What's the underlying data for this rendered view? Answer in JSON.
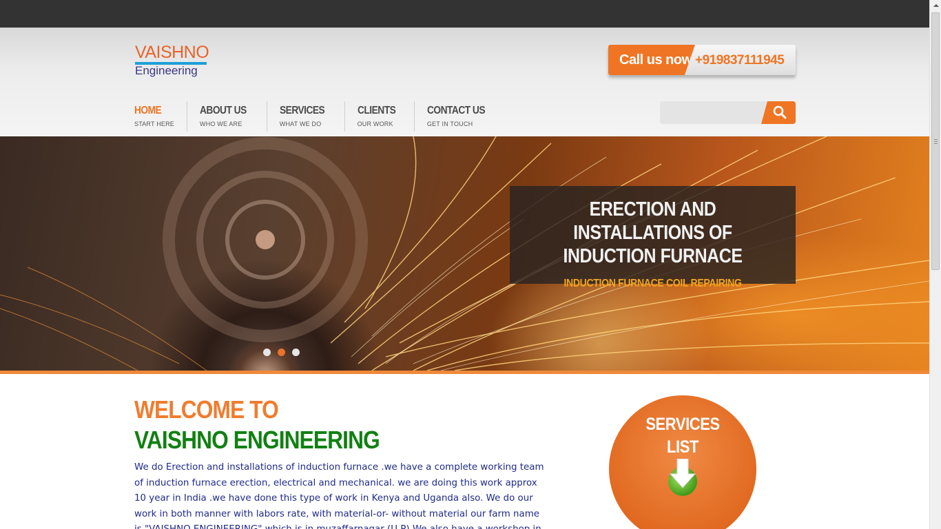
{
  "logo": {
    "line1": "VAISHNO",
    "line2": "Engineering"
  },
  "call": {
    "label": "Call us now",
    "number": "+919837111945"
  },
  "nav": [
    {
      "title": "HOME",
      "sub": "START HERE",
      "active": true
    },
    {
      "title": "ABOUT US",
      "sub": "WHO WE ARE"
    },
    {
      "title": "SERVICES",
      "sub": "WHAT WE DO"
    },
    {
      "title": "CLIENTS",
      "sub": "OUR WORK"
    },
    {
      "title": "CONTACT US",
      "sub": "GET IN TOUCH"
    }
  ],
  "search": {
    "placeholder": ""
  },
  "hero": {
    "title": "ERECTION AND INSTALLATIONS OF INDUCTION FURNACE",
    "subtitle": "INDUCTION FURNACE COIL REPAIRING",
    "slides": 3,
    "active_slide": 2
  },
  "welcome": {
    "line1": "WELCOME TO",
    "line2": "VAISHNO ENGINEERING",
    "text": "We do Erection and installations of induction furnace .we have a complete working team of induction furnace erection, electrical and mechanical. we are doing this work approx 10 year in India .we have done this type of work in Kenya and Uganda also. We do our work in both manner with labors rate, with material-or- without material our farm name is \"VAISHNO ENGINEERING\" which is in muzaffarnagar (U.P) We also have a workshop in"
  },
  "services": {
    "label": "SERVICES LIST",
    "icon": "down-arrow-icon"
  },
  "colors": {
    "accent": "#ef7524",
    "green": "#118012",
    "text_blue": "#1f2a8a"
  }
}
